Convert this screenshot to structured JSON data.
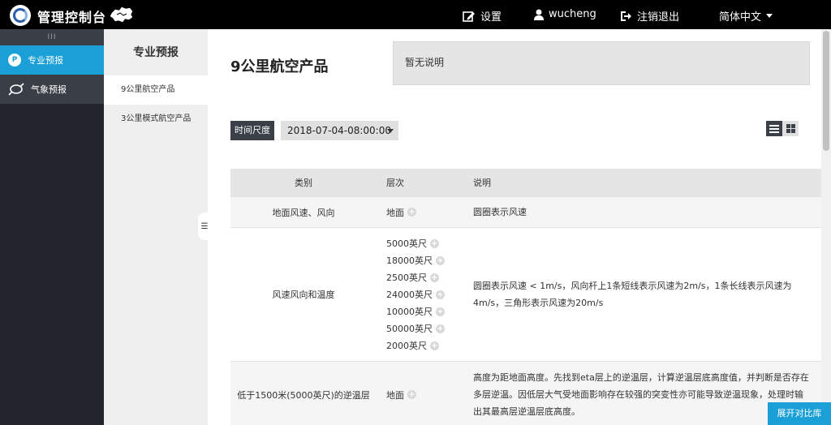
{
  "header": {
    "app_title": "管理控制台",
    "settings_label": "设置",
    "username": "wucheng",
    "logout_label": "注销退出",
    "language_label": "简体中文"
  },
  "sidebar": {
    "collapse_glyph": "III",
    "items": [
      {
        "label": "专业预报",
        "icon": "p-badge-icon",
        "active": true
      },
      {
        "label": "气象预报",
        "icon": "typhoon-icon",
        "active": false
      }
    ]
  },
  "submenu": {
    "title": "专业预报",
    "items": [
      {
        "label": "9公里航空产品",
        "active": true
      },
      {
        "label": "3公里模式航空产品",
        "active": false
      }
    ]
  },
  "main": {
    "title": "9公里航空产品",
    "description": "暂无说明",
    "time_scale_label": "时间尺度",
    "time_value": "2018-07-04-08:00:00",
    "table": {
      "headers": [
        "类别",
        "层次",
        "说明"
      ],
      "rows": [
        {
          "category": "地面风速、风向",
          "levels": [
            "地面"
          ],
          "description": "圆圈表示风速"
        },
        {
          "category": "风速风向和温度",
          "levels": [
            "5000英尺",
            "18000英尺",
            "2500英尺",
            "24000英尺",
            "10000英尺",
            "50000英尺",
            "2000英尺"
          ],
          "description": "圆圈表示风速 < 1m/s，风向杆上1条短线表示风速为2m/s，1条长线表示风速为4m/s，三角形表示风速为20m/s"
        },
        {
          "category": "低于1500米(5000英尺)的逆温层",
          "levels": [
            "地面"
          ],
          "description": "高度为距地面高度。先找到eta层上的逆温层，计算逆温层底高度值，并判断是否存在多层逆温。因低层大气受地面影响存在较强的突变性亦可能导致逆温现象，处理时输出其最高层逆温层底高度。"
        }
      ]
    }
  },
  "compare_button_label": "展开对比库",
  "colors": {
    "accent": "#1a9fd6",
    "topbar": "#000000",
    "sidebar": "#22262c",
    "label_dark": "#3b4048"
  }
}
